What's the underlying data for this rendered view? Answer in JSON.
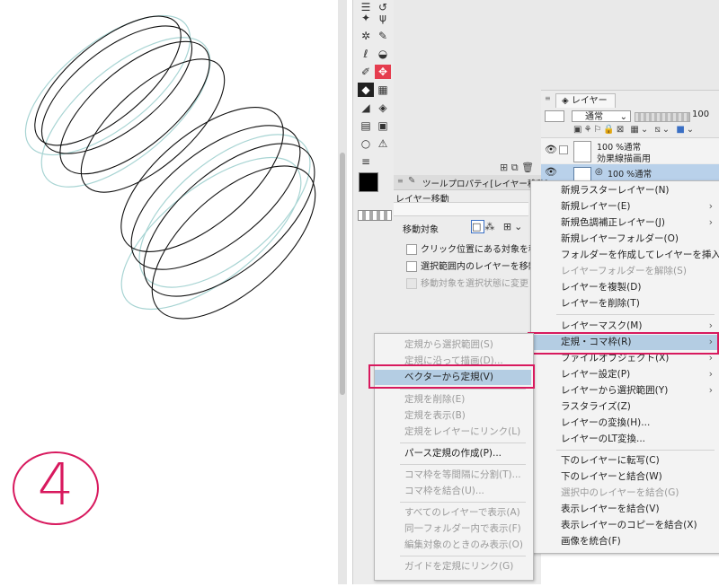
{
  "window": {
    "accent": "#d8195e",
    "highlight": "#b4cde3"
  },
  "annotation": {
    "number": "4"
  },
  "layer_panel": {
    "tab_label": "レイヤー",
    "blend_mode": "通常",
    "opacity": "100",
    "layer1": {
      "line1": "100 %通常",
      "line2": "効果線描画用"
    },
    "layer2": {
      "line1": "100 %通常"
    }
  },
  "tool_property": {
    "title": "ツールプロパティ[レイヤー移動]",
    "subtitle": "レイヤー移動",
    "move_target_label": "移動対象",
    "options": [
      {
        "label": "クリック位置にある対象を移動",
        "enabled": true
      },
      {
        "label": "選択範囲内のレイヤーを移動",
        "enabled": true
      },
      {
        "label": "移動対象を選択状態に変更",
        "enabled": false
      }
    ]
  },
  "layer_menu": {
    "items": [
      {
        "label": "新規ラスターレイヤー(N)",
        "enabled": true,
        "arrow": false
      },
      {
        "label": "新規レイヤー(E)",
        "enabled": true,
        "arrow": true
      },
      {
        "label": "新規色調補正レイヤー(J)",
        "enabled": true,
        "arrow": true
      },
      {
        "label": "新規レイヤーフォルダー(O)",
        "enabled": true,
        "arrow": false
      },
      {
        "label": "フォルダーを作成してレイヤーを挿入(F)",
        "enabled": true,
        "arrow": false
      },
      {
        "label": "レイヤーフォルダーを解除(S)",
        "enabled": false,
        "arrow": false
      },
      {
        "label": "レイヤーを複製(D)",
        "enabled": true,
        "arrow": false
      },
      {
        "label": "レイヤーを削除(T)",
        "enabled": true,
        "arrow": false
      },
      {
        "label": "レイヤーマスク(M)",
        "enabled": true,
        "arrow": true
      },
      {
        "label": "定規・コマ枠(R)",
        "enabled": true,
        "arrow": true,
        "highlight": true
      },
      {
        "label": "ファイルオブジェクト(X)",
        "enabled": true,
        "arrow": true
      },
      {
        "label": "レイヤー設定(P)",
        "enabled": true,
        "arrow": true
      },
      {
        "label": "レイヤーから選択範囲(Y)",
        "enabled": true,
        "arrow": true
      },
      {
        "label": "ラスタライズ(Z)",
        "enabled": true,
        "arrow": false
      },
      {
        "label": "レイヤーの変換(H)...",
        "enabled": true,
        "arrow": false
      },
      {
        "label": "レイヤーのLT変換...",
        "enabled": true,
        "arrow": false
      },
      {
        "label": "下のレイヤーに転写(C)",
        "enabled": true,
        "arrow": false
      },
      {
        "label": "下のレイヤーと結合(W)",
        "enabled": true,
        "arrow": false
      },
      {
        "label": "選択中のレイヤーを結合(G)",
        "enabled": false,
        "arrow": false
      },
      {
        "label": "表示レイヤーを結合(V)",
        "enabled": true,
        "arrow": false
      },
      {
        "label": "表示レイヤーのコピーを結合(X)",
        "enabled": true,
        "arrow": false
      },
      {
        "label": "画像を統合(F)",
        "enabled": true,
        "arrow": false
      }
    ]
  },
  "ruler_menu": {
    "items": [
      {
        "label": "定規から選択範囲(S)",
        "enabled": false
      },
      {
        "label": "定規に沿って描画(D)...",
        "enabled": false
      },
      {
        "label": "ベクターから定規(V)",
        "enabled": true,
        "highlight": true
      },
      {
        "label": "定規を削除(E)",
        "enabled": false
      },
      {
        "label": "定規を表示(B)",
        "enabled": false
      },
      {
        "label": "定規をレイヤーにリンク(L)",
        "enabled": false
      },
      {
        "label": "パース定規の作成(P)...",
        "enabled": true
      },
      {
        "label": "コマ枠を等間隔に分割(T)...",
        "enabled": false
      },
      {
        "label": "コマ枠を結合(U)...",
        "enabled": false
      },
      {
        "label": "すべてのレイヤーで表示(A)",
        "enabled": false
      },
      {
        "label": "同一フォルダー内で表示(F)",
        "enabled": false
      },
      {
        "label": "編集対象のときのみ表示(O)",
        "enabled": false
      },
      {
        "label": "ガイドを定規にリンク(G)",
        "enabled": false
      }
    ]
  }
}
